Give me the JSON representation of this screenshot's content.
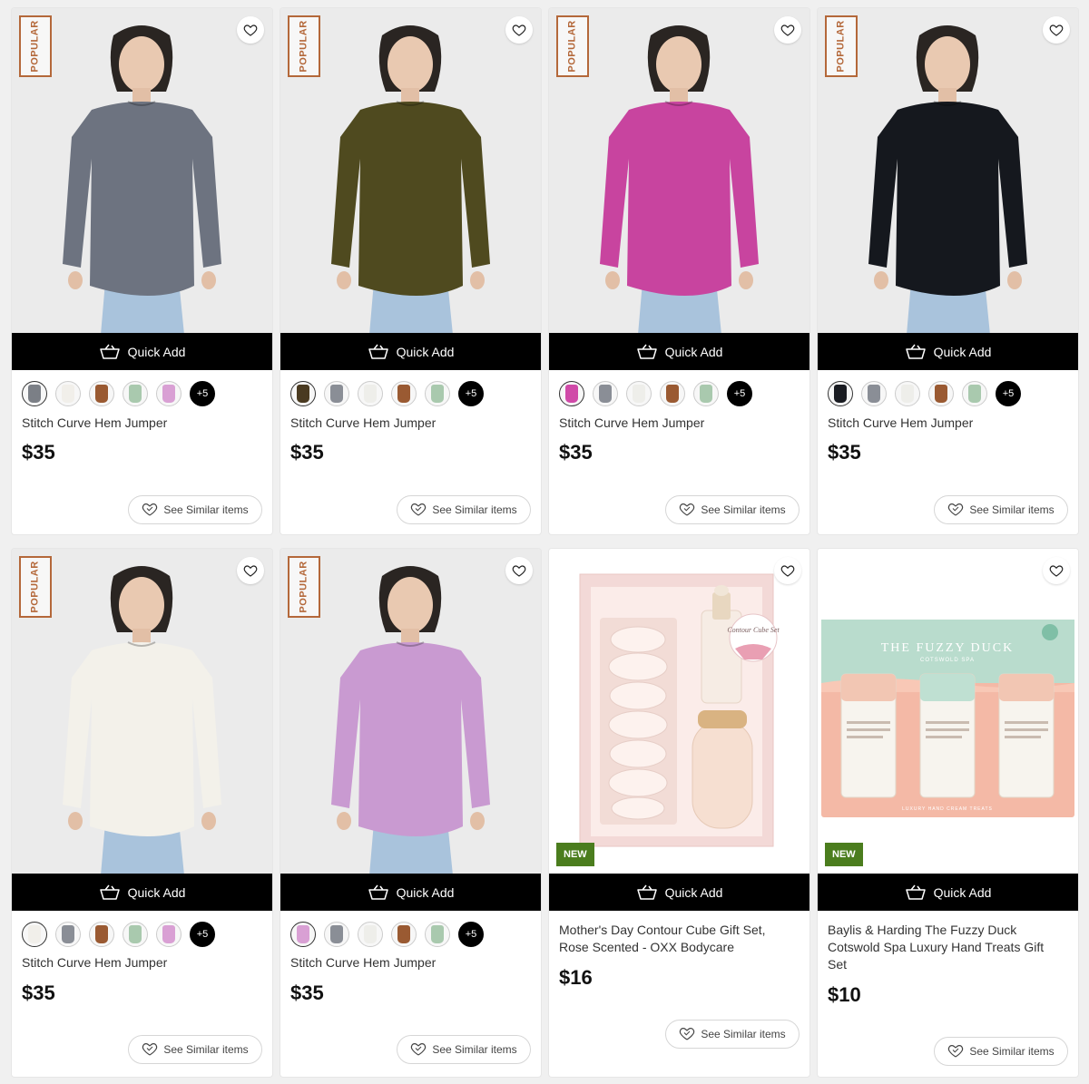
{
  "labels": {
    "quick_add": "Quick Add",
    "see_similar": "See Similar items",
    "popular": "POPULAR",
    "new": "NEW"
  },
  "products": [
    {
      "title": "Stitch Curve Hem Jumper",
      "price": "$35",
      "badge": "POPULAR",
      "more_colors": "+5",
      "sweater_color": "#6d7380",
      "swatches": [
        "#7b7f86",
        "#f1efea",
        "#9a5a32",
        "#a9c9ae",
        "#d9a0d4"
      ]
    },
    {
      "title": "Stitch Curve Hem Jumper",
      "price": "$35",
      "badge": "POPULAR",
      "more_colors": "+5",
      "sweater_color": "#4f4a1f",
      "swatches": [
        "#4a3a20",
        "#8a8e96",
        "#eeeeea",
        "#9a5a32",
        "#a9c9ae"
      ]
    },
    {
      "title": "Stitch Curve Hem Jumper",
      "price": "$35",
      "badge": "POPULAR",
      "more_colors": "+5",
      "sweater_color": "#c8449f",
      "swatches": [
        "#d04aa8",
        "#8a8e96",
        "#eeeeea",
        "#9a5a32",
        "#a9c9ae"
      ]
    },
    {
      "title": "Stitch Curve Hem Jumper",
      "price": "$35",
      "badge": "POPULAR",
      "more_colors": "+5",
      "sweater_color": "#15181e",
      "swatches": [
        "#1a1c22",
        "#8a8e96",
        "#eeeeea",
        "#9a5a32",
        "#a9c9ae"
      ]
    },
    {
      "title": "Stitch Curve Hem Jumper",
      "price": "$35",
      "badge": "POPULAR",
      "more_colors": "+5",
      "sweater_color": "#f3f1ea",
      "swatches": [
        "#f1efea",
        "#8a8e96",
        "#9a5a32",
        "#a9c9ae",
        "#d9a0d4"
      ]
    },
    {
      "title": "Stitch Curve Hem Jumper",
      "price": "$35",
      "badge": "POPULAR",
      "more_colors": "+5",
      "sweater_color": "#c99ad1",
      "swatches": [
        "#d9a0d4",
        "#8a8e96",
        "#eeeeea",
        "#9a5a32",
        "#a9c9ae"
      ]
    },
    {
      "title": "Mother's Day Contour Cube Gift Set, Rose Scented - OXX Bodycare",
      "price": "$16",
      "badge": "NEW"
    },
    {
      "title": "Baylis & Harding The Fuzzy Duck Cotswold Spa Luxury Hand Treats Gift Set",
      "price": "$10",
      "badge": "NEW"
    }
  ],
  "gift_text": {
    "contour_tag": "Contour Cube Set",
    "fuzzy_brand": "THE FUZZY DUCK",
    "fuzzy_sub": "COTSWOLD SPA",
    "fuzzy_footer": "LUXURY HAND CREAM TREATS"
  },
  "colors": {
    "popular": "#b4683a",
    "new": "#4b7d1e",
    "quick_add_bg": "#000000"
  }
}
